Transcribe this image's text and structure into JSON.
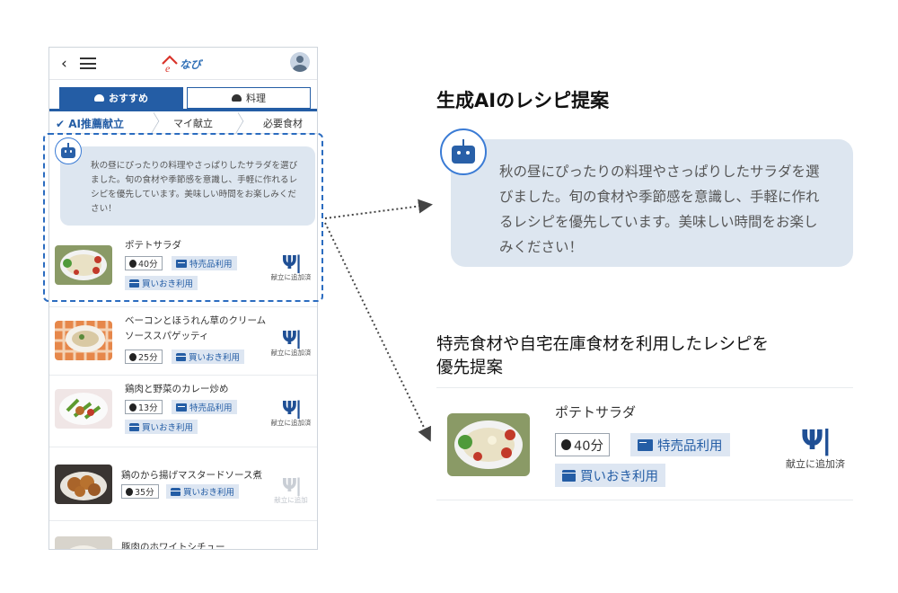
{
  "phone": {
    "back_icon": "chevron-left-icon",
    "menu_icon": "hamburger-menu-icon",
    "logo_text": "なび",
    "tabs": [
      {
        "label": "おすすめ",
        "icon": "chef-hat-icon",
        "active": true
      },
      {
        "label": "料理",
        "icon": "chef-hat-icon",
        "active": false
      }
    ],
    "steps": [
      {
        "label": "AI推薦献立",
        "checked": true
      },
      {
        "label": "マイ献立"
      },
      {
        "label": "必要食材"
      }
    ],
    "ai_message": "秋の昼にぴったりの料理やさっぱりしたサラダを選びました。旬の食材や季節感を意識し、手軽に作れるレシピを優先しています。美味しい時間をお楽しみください！",
    "recipes": [
      {
        "title": "ポテトサラダ",
        "time": "40分",
        "badges": [
          "特売品利用",
          "買いおき利用"
        ],
        "action": "献立に追加済",
        "added": true
      },
      {
        "title": "ベーコンとほうれん草のクリームソーススパゲッティ",
        "title_line1": "ベーコンとほうれん草のクリーム",
        "title_line2": "ソーススパゲッティ",
        "time": "25分",
        "badges": [
          "買いおき利用"
        ],
        "action": "献立に追加済",
        "added": true
      },
      {
        "title": "鶏肉と野菜のカレー炒め",
        "time": "13分",
        "badges": [
          "特売品利用",
          "買いおき利用"
        ],
        "action": "献立に追加済",
        "added": true
      },
      {
        "title": "鶏のから揚げマスタードソース煮",
        "time": "35分",
        "badges": [
          "買いおき利用"
        ],
        "action": "献立に追加",
        "added": false
      },
      {
        "title": "豚肉のホワイトシチュー"
      }
    ]
  },
  "callout_ai": {
    "heading": "生成AIのレシピ提案",
    "message": "秋の昼にぴったりの料理やさっぱりしたサラダを選びました。旬の食材や季節感を意識し、手軽に作れるレシピを優先しています。美味しい時間をお楽しみください！"
  },
  "callout_recipe": {
    "heading_line1": "特売食材や自宅在庫食材を利用したレシピを",
    "heading_line2": "優先提案",
    "title": "ポテトサラダ",
    "time": "40分",
    "badges": [
      "特売品利用",
      "買いおき利用"
    ],
    "action": "献立に追加済"
  },
  "colors": {
    "accent": "#245da5",
    "bubble": "#dde6f0",
    "dash": "#2b6cc0"
  }
}
